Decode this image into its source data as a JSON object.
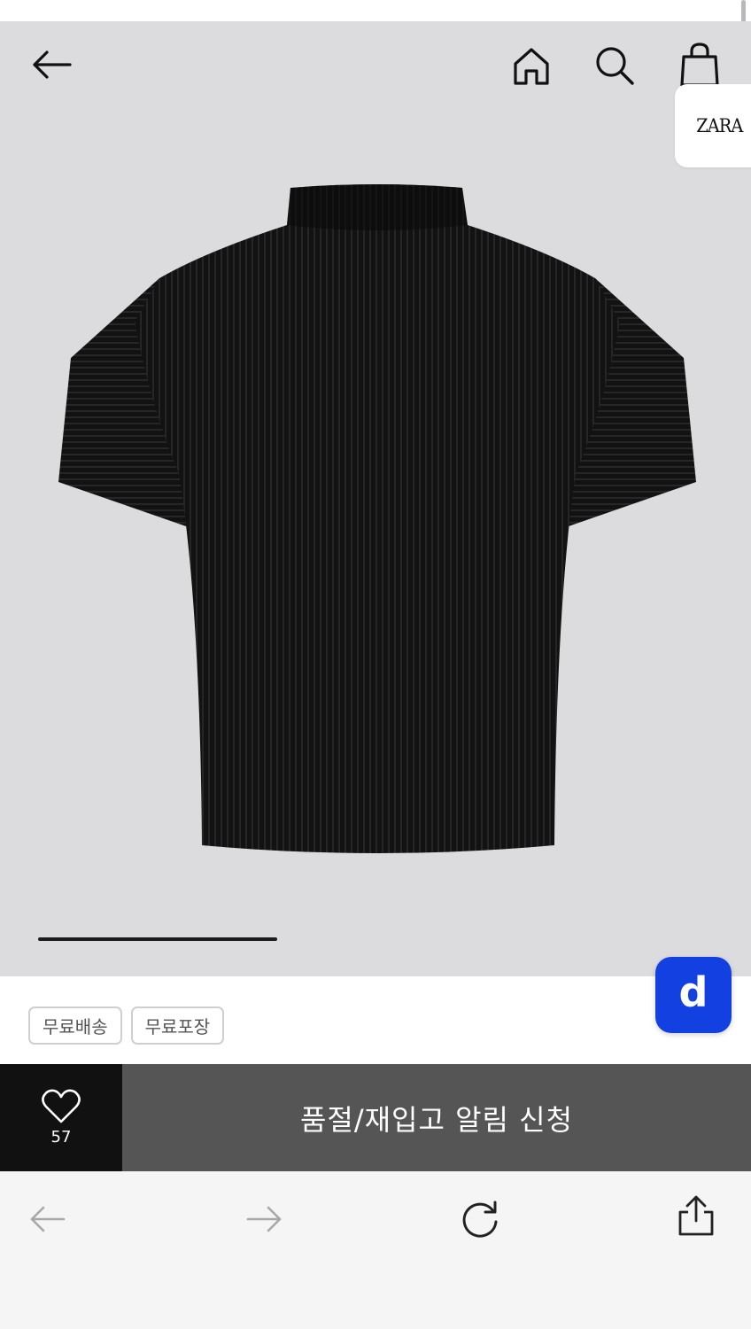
{
  "header": {
    "back_icon": "arrow-left-icon",
    "home_icon": "home-icon",
    "search_icon": "search-icon",
    "cart_icon": "shopping-bag-icon"
  },
  "brand": {
    "name": "ZARA"
  },
  "product": {
    "image_icon": "black-pleated-tshirt",
    "image_progress": 0.33
  },
  "floating_app": {
    "label": "d",
    "color": "#1340e0"
  },
  "tags": [
    {
      "label": "무료배송"
    },
    {
      "label": "무료포장"
    }
  ],
  "action_bar": {
    "like_icon": "heart-icon",
    "like_count": "57",
    "restock_label": "품절/재입고 알림 신청"
  },
  "browser_toolbar": {
    "back_icon": "arrow-left-icon",
    "forward_icon": "arrow-right-icon",
    "reload_icon": "reload-icon",
    "share_icon": "share-icon"
  },
  "colors": {
    "hero_bg": "#dcdcde",
    "like_bg": "#111111",
    "restock_bg": "#555555",
    "toolbar_bg": "#f5f5f5"
  }
}
